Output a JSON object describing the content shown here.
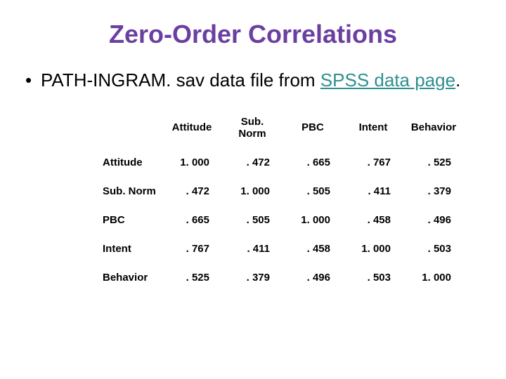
{
  "title": "Zero-Order Correlations",
  "bullet": {
    "pre": "PATH-INGRAM. sav data file from ",
    "link_text": "SPSS data page",
    "post": "."
  },
  "table": {
    "columns": [
      "Attitude",
      "Sub. Norm",
      "PBC",
      "Intent",
      "Behavior"
    ],
    "rows": [
      {
        "label": "Attitude",
        "values": [
          "1. 000",
          ". 472",
          ". 665",
          ". 767",
          ". 525"
        ]
      },
      {
        "label": "Sub. Norm",
        "values": [
          ". 472",
          "1. 000",
          ". 505",
          ". 411",
          ". 379"
        ]
      },
      {
        "label": "PBC",
        "values": [
          ". 665",
          ". 505",
          "1. 000",
          ". 458",
          ". 496"
        ]
      },
      {
        "label": "Intent",
        "values": [
          ". 767",
          ". 411",
          ". 458",
          "1. 000",
          ". 503"
        ]
      },
      {
        "label": "Behavior",
        "values": [
          ". 525",
          ". 379",
          ". 496",
          ". 503",
          "1. 000"
        ]
      }
    ]
  }
}
